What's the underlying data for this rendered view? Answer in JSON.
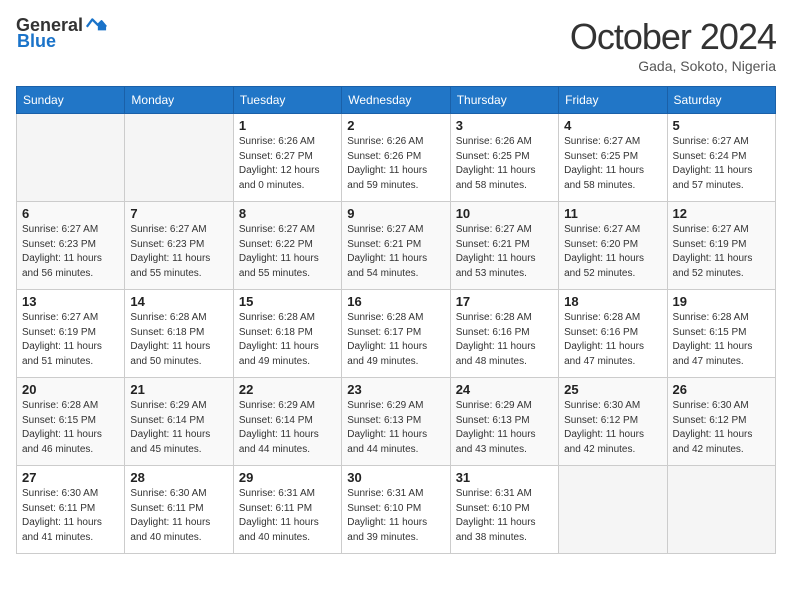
{
  "header": {
    "logo_general": "General",
    "logo_blue": "Blue",
    "month_title": "October 2024",
    "subtitle": "Gada, Sokoto, Nigeria"
  },
  "days_of_week": [
    "Sunday",
    "Monday",
    "Tuesday",
    "Wednesday",
    "Thursday",
    "Friday",
    "Saturday"
  ],
  "weeks": [
    [
      {
        "day": "",
        "sunrise": "",
        "sunset": "",
        "daylight": "",
        "empty": true
      },
      {
        "day": "",
        "sunrise": "",
        "sunset": "",
        "daylight": "",
        "empty": true
      },
      {
        "day": "1",
        "sunrise": "Sunrise: 6:26 AM",
        "sunset": "Sunset: 6:27 PM",
        "daylight": "Daylight: 12 hours and 0 minutes."
      },
      {
        "day": "2",
        "sunrise": "Sunrise: 6:26 AM",
        "sunset": "Sunset: 6:26 PM",
        "daylight": "Daylight: 11 hours and 59 minutes."
      },
      {
        "day": "3",
        "sunrise": "Sunrise: 6:26 AM",
        "sunset": "Sunset: 6:25 PM",
        "daylight": "Daylight: 11 hours and 58 minutes."
      },
      {
        "day": "4",
        "sunrise": "Sunrise: 6:27 AM",
        "sunset": "Sunset: 6:25 PM",
        "daylight": "Daylight: 11 hours and 58 minutes."
      },
      {
        "day": "5",
        "sunrise": "Sunrise: 6:27 AM",
        "sunset": "Sunset: 6:24 PM",
        "daylight": "Daylight: 11 hours and 57 minutes."
      }
    ],
    [
      {
        "day": "6",
        "sunrise": "Sunrise: 6:27 AM",
        "sunset": "Sunset: 6:23 PM",
        "daylight": "Daylight: 11 hours and 56 minutes."
      },
      {
        "day": "7",
        "sunrise": "Sunrise: 6:27 AM",
        "sunset": "Sunset: 6:23 PM",
        "daylight": "Daylight: 11 hours and 55 minutes."
      },
      {
        "day": "8",
        "sunrise": "Sunrise: 6:27 AM",
        "sunset": "Sunset: 6:22 PM",
        "daylight": "Daylight: 11 hours and 55 minutes."
      },
      {
        "day": "9",
        "sunrise": "Sunrise: 6:27 AM",
        "sunset": "Sunset: 6:21 PM",
        "daylight": "Daylight: 11 hours and 54 minutes."
      },
      {
        "day": "10",
        "sunrise": "Sunrise: 6:27 AM",
        "sunset": "Sunset: 6:21 PM",
        "daylight": "Daylight: 11 hours and 53 minutes."
      },
      {
        "day": "11",
        "sunrise": "Sunrise: 6:27 AM",
        "sunset": "Sunset: 6:20 PM",
        "daylight": "Daylight: 11 hours and 52 minutes."
      },
      {
        "day": "12",
        "sunrise": "Sunrise: 6:27 AM",
        "sunset": "Sunset: 6:19 PM",
        "daylight": "Daylight: 11 hours and 52 minutes."
      }
    ],
    [
      {
        "day": "13",
        "sunrise": "Sunrise: 6:27 AM",
        "sunset": "Sunset: 6:19 PM",
        "daylight": "Daylight: 11 hours and 51 minutes."
      },
      {
        "day": "14",
        "sunrise": "Sunrise: 6:28 AM",
        "sunset": "Sunset: 6:18 PM",
        "daylight": "Daylight: 11 hours and 50 minutes."
      },
      {
        "day": "15",
        "sunrise": "Sunrise: 6:28 AM",
        "sunset": "Sunset: 6:18 PM",
        "daylight": "Daylight: 11 hours and 49 minutes."
      },
      {
        "day": "16",
        "sunrise": "Sunrise: 6:28 AM",
        "sunset": "Sunset: 6:17 PM",
        "daylight": "Daylight: 11 hours and 49 minutes."
      },
      {
        "day": "17",
        "sunrise": "Sunrise: 6:28 AM",
        "sunset": "Sunset: 6:16 PM",
        "daylight": "Daylight: 11 hours and 48 minutes."
      },
      {
        "day": "18",
        "sunrise": "Sunrise: 6:28 AM",
        "sunset": "Sunset: 6:16 PM",
        "daylight": "Daylight: 11 hours and 47 minutes."
      },
      {
        "day": "19",
        "sunrise": "Sunrise: 6:28 AM",
        "sunset": "Sunset: 6:15 PM",
        "daylight": "Daylight: 11 hours and 47 minutes."
      }
    ],
    [
      {
        "day": "20",
        "sunrise": "Sunrise: 6:28 AM",
        "sunset": "Sunset: 6:15 PM",
        "daylight": "Daylight: 11 hours and 46 minutes."
      },
      {
        "day": "21",
        "sunrise": "Sunrise: 6:29 AM",
        "sunset": "Sunset: 6:14 PM",
        "daylight": "Daylight: 11 hours and 45 minutes."
      },
      {
        "day": "22",
        "sunrise": "Sunrise: 6:29 AM",
        "sunset": "Sunset: 6:14 PM",
        "daylight": "Daylight: 11 hours and 44 minutes."
      },
      {
        "day": "23",
        "sunrise": "Sunrise: 6:29 AM",
        "sunset": "Sunset: 6:13 PM",
        "daylight": "Daylight: 11 hours and 44 minutes."
      },
      {
        "day": "24",
        "sunrise": "Sunrise: 6:29 AM",
        "sunset": "Sunset: 6:13 PM",
        "daylight": "Daylight: 11 hours and 43 minutes."
      },
      {
        "day": "25",
        "sunrise": "Sunrise: 6:30 AM",
        "sunset": "Sunset: 6:12 PM",
        "daylight": "Daylight: 11 hours and 42 minutes."
      },
      {
        "day": "26",
        "sunrise": "Sunrise: 6:30 AM",
        "sunset": "Sunset: 6:12 PM",
        "daylight": "Daylight: 11 hours and 42 minutes."
      }
    ],
    [
      {
        "day": "27",
        "sunrise": "Sunrise: 6:30 AM",
        "sunset": "Sunset: 6:11 PM",
        "daylight": "Daylight: 11 hours and 41 minutes."
      },
      {
        "day": "28",
        "sunrise": "Sunrise: 6:30 AM",
        "sunset": "Sunset: 6:11 PM",
        "daylight": "Daylight: 11 hours and 40 minutes."
      },
      {
        "day": "29",
        "sunrise": "Sunrise: 6:31 AM",
        "sunset": "Sunset: 6:11 PM",
        "daylight": "Daylight: 11 hours and 40 minutes."
      },
      {
        "day": "30",
        "sunrise": "Sunrise: 6:31 AM",
        "sunset": "Sunset: 6:10 PM",
        "daylight": "Daylight: 11 hours and 39 minutes."
      },
      {
        "day": "31",
        "sunrise": "Sunrise: 6:31 AM",
        "sunset": "Sunset: 6:10 PM",
        "daylight": "Daylight: 11 hours and 38 minutes."
      },
      {
        "day": "",
        "sunrise": "",
        "sunset": "",
        "daylight": "",
        "empty": true
      },
      {
        "day": "",
        "sunrise": "",
        "sunset": "",
        "daylight": "",
        "empty": true
      }
    ]
  ]
}
